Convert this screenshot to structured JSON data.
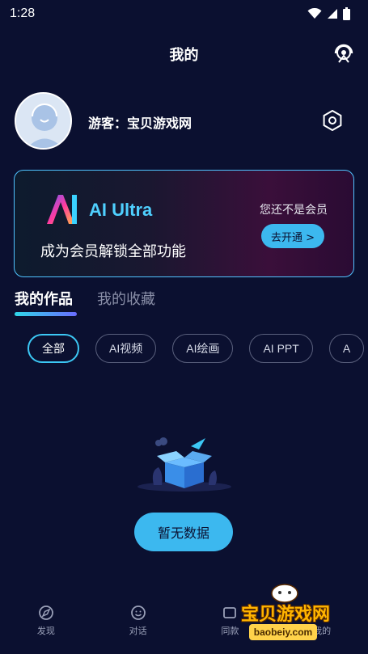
{
  "status_bar": {
    "time": "1:28"
  },
  "header": {
    "title": "我的"
  },
  "profile": {
    "username": "游客：宝贝游戏网"
  },
  "vip": {
    "logo_text": "AI Ultra",
    "description": "成为会员解锁全部功能",
    "status": "您还不是会员",
    "button_label": "去开通 >"
  },
  "tabs": [
    {
      "label": "我的作品",
      "active": true
    },
    {
      "label": "我的收藏",
      "active": false
    }
  ],
  "filters": [
    {
      "label": "全部",
      "active": true
    },
    {
      "label": "AI视频"
    },
    {
      "label": "AI绘画"
    },
    {
      "label": "AI PPT"
    },
    {
      "label": "A"
    }
  ],
  "empty_state": {
    "button_label": "暂无数据"
  },
  "bottom_nav": [
    {
      "label": "发现",
      "icon": "compass-icon"
    },
    {
      "label": "对话",
      "icon": "smile-chat-icon"
    },
    {
      "label": "同款",
      "icon": "template-icon"
    },
    {
      "label": "我的",
      "icon": "user-icon"
    }
  ],
  "watermark": {
    "text": "宝贝游戏网",
    "url": "baobeiy.com"
  },
  "colors": {
    "background": "#0b1030",
    "accent": "#3cb8ef",
    "accent_text": "#4fd0ff"
  }
}
